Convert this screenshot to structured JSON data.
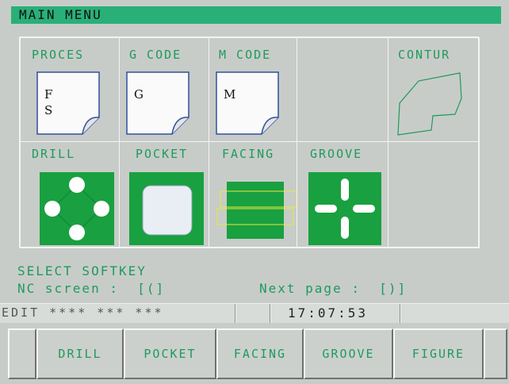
{
  "title": "MAIN MENU",
  "tiles": {
    "proces": {
      "label": "PROCES",
      "line1": "F",
      "line2": "S"
    },
    "gcode": {
      "label": "G CODE",
      "glyph": "G"
    },
    "mcode": {
      "label": "M CODE",
      "glyph": "M"
    },
    "contur": {
      "label": "CONTUR"
    },
    "drill": {
      "label": "DRILL"
    },
    "pocket": {
      "label": "POCKET"
    },
    "facing": {
      "label": "FACING"
    },
    "groove": {
      "label": "GROOVE"
    }
  },
  "messages": {
    "select": "SELECT SOFTKEY",
    "nc_screen": "NC screen :  [(]",
    "next_page": "Next page :  [)]"
  },
  "status": {
    "mode": "EDIT **** *** ***",
    "time": "17:07:53"
  },
  "softkeys": [
    "DRILL",
    "POCKET",
    "FACING",
    "GROOVE",
    "FIGURE"
  ],
  "colors": {
    "accent": "#28b078",
    "label": "#1e9a5e",
    "icon_fill": "#19a040"
  }
}
